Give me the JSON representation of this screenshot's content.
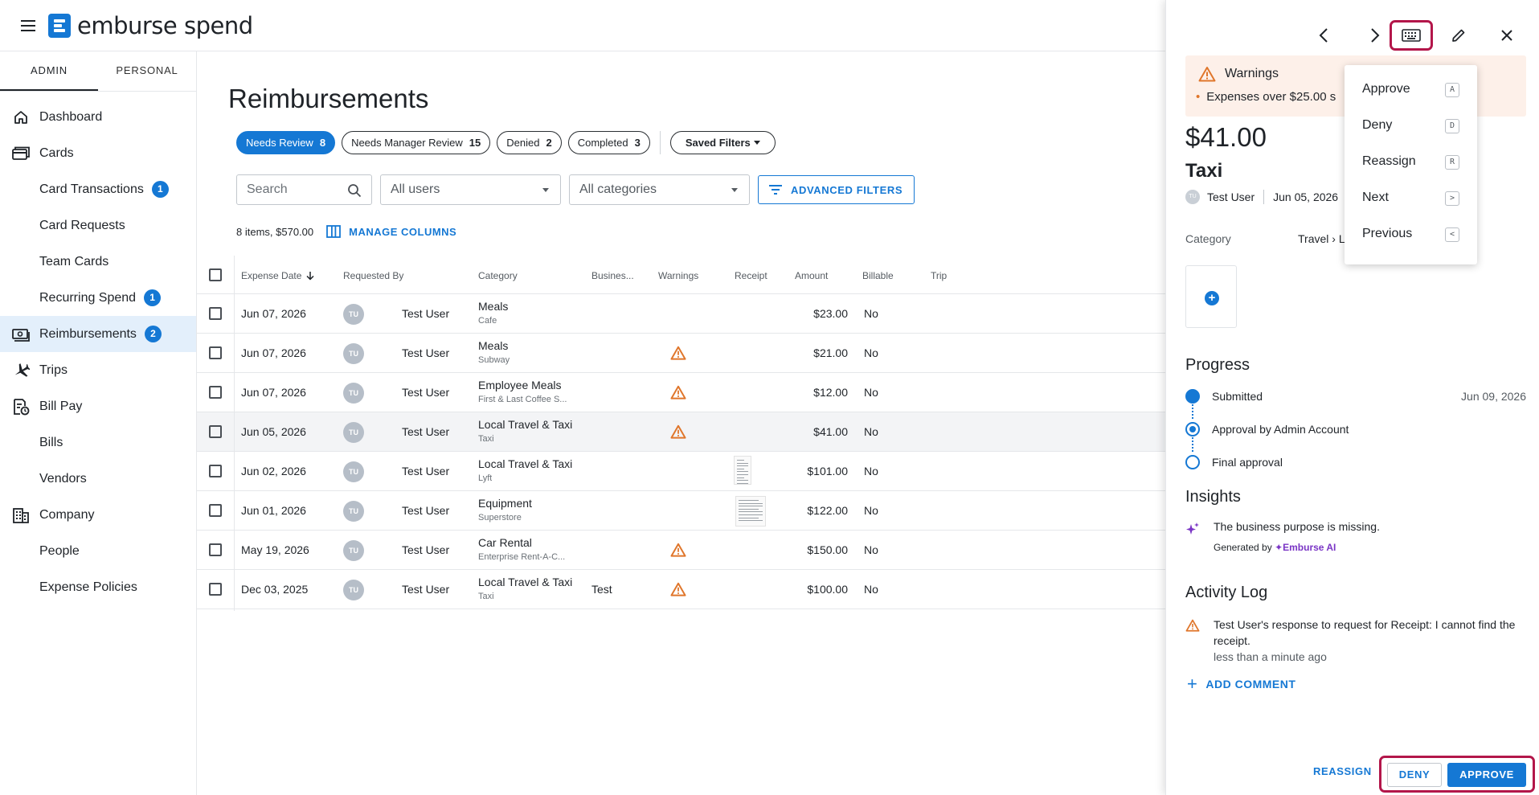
{
  "app": {
    "logo_text": "emburse spend"
  },
  "sidebar": {
    "modes": [
      "ADMIN",
      "PERSONAL"
    ],
    "items": [
      {
        "label": "Dashboard",
        "icon": "home-icon"
      },
      {
        "label": "Cards",
        "icon": "cards-icon"
      },
      {
        "label": "Card Transactions",
        "badge": "1"
      },
      {
        "label": "Card Requests"
      },
      {
        "label": "Team Cards"
      },
      {
        "label": "Recurring Spend",
        "badge": "1"
      },
      {
        "label": "Reimbursements",
        "icon": "reimbursement-icon",
        "badge": "2",
        "active": true
      },
      {
        "label": "Trips",
        "icon": "plane-icon"
      },
      {
        "label": "Bill Pay",
        "icon": "bill-icon"
      },
      {
        "label": "Bills"
      },
      {
        "label": "Vendors"
      },
      {
        "label": "Company",
        "icon": "building-icon"
      },
      {
        "label": "People"
      },
      {
        "label": "Expense Policies"
      }
    ]
  },
  "main": {
    "title": "Reimbursements",
    "chips": [
      {
        "label": "Needs Review",
        "count": "8",
        "active": true
      },
      {
        "label": "Needs Manager Review",
        "count": "15"
      },
      {
        "label": "Denied",
        "count": "2"
      },
      {
        "label": "Completed",
        "count": "3"
      }
    ],
    "saved_filters": "Saved Filters",
    "search_placeholder": "Search",
    "users_select": "All users",
    "categories_select": "All categories",
    "advanced_filters": "ADVANCED FILTERS",
    "summary": "8 items, $570.00",
    "manage_columns": "MANAGE COLUMNS",
    "columns": [
      "Expense Date",
      "Requested By",
      "Category",
      "Busines...",
      "Warnings",
      "Receipt",
      "Amount",
      "Billable",
      "Trip"
    ],
    "rows": [
      {
        "date": "Jun 07, 2026",
        "initials": "TU",
        "user": "Test User",
        "category": "Meals",
        "merchant": "Cafe",
        "business": "",
        "warning": false,
        "receipt": "",
        "amount": "$23.00",
        "billable": "No"
      },
      {
        "date": "Jun 07, 2026",
        "initials": "TU",
        "user": "Test User",
        "category": "Meals",
        "merchant": "Subway",
        "business": "",
        "warning": true,
        "receipt": "",
        "amount": "$21.00",
        "billable": "No"
      },
      {
        "date": "Jun 07, 2026",
        "initials": "TU",
        "user": "Test User",
        "category": "Employee Meals",
        "merchant": "First & Last Coffee S...",
        "business": "",
        "warning": true,
        "receipt": "",
        "amount": "$12.00",
        "billable": "No"
      },
      {
        "date": "Jun 05, 2026",
        "initials": "TU",
        "user": "Test User",
        "category": "Local Travel & Taxi",
        "merchant": "Taxi",
        "business": "",
        "warning": true,
        "receipt": "",
        "amount": "$41.00",
        "billable": "No",
        "highlight": true
      },
      {
        "date": "Jun 02, 2026",
        "initials": "TU",
        "user": "Test User",
        "category": "Local Travel & Taxi",
        "merchant": "Lyft",
        "business": "",
        "warning": false,
        "receipt": "narrow",
        "amount": "$101.00",
        "billable": "No"
      },
      {
        "date": "Jun 01, 2026",
        "initials": "TU",
        "user": "Test User",
        "category": "Equipment",
        "merchant": "Superstore",
        "business": "",
        "warning": false,
        "receipt": "wide",
        "amount": "$122.00",
        "billable": "No"
      },
      {
        "date": "May 19, 2026",
        "initials": "TU",
        "user": "Test User",
        "category": "Car Rental",
        "merchant": "Enterprise Rent-A-C...",
        "business": "",
        "warning": true,
        "receipt": "",
        "amount": "$150.00",
        "billable": "No"
      },
      {
        "date": "Dec 03, 2025",
        "initials": "TU",
        "user": "Test User",
        "category": "Local Travel & Taxi",
        "merchant": "Taxi",
        "business": "Test",
        "warning": true,
        "receipt": "",
        "amount": "$100.00",
        "billable": "No"
      }
    ]
  },
  "panel": {
    "warnings_title": "Warnings",
    "warning_text": "Expenses over $25.00 s",
    "amount": "$41.00",
    "merchant": "Taxi",
    "avatar_initials": "TU",
    "user": "Test User",
    "date": "Jun 05, 2026",
    "category_label": "Category",
    "category_value": "Travel › Lo",
    "progress_title": "Progress",
    "steps": [
      {
        "label": "Submitted",
        "date": "Jun 09, 2026"
      },
      {
        "label": "Approval by Admin Account",
        "date": ""
      },
      {
        "label": "Final approval",
        "date": ""
      }
    ],
    "insights_title": "Insights",
    "insight_text": "The business purpose is missing.",
    "generated_by": "Generated by",
    "ai_name": "Emburse AI",
    "activity_title": "Activity Log",
    "activity_text": "Test User's response to request for Receipt: I cannot find the receipt.",
    "activity_time": "less than a minute ago",
    "add_comment": "ADD COMMENT",
    "reassign": "REASSIGN",
    "deny": "DENY",
    "approve": "APPROVE"
  },
  "shortcut_menu": [
    {
      "label": "Approve",
      "key": "A"
    },
    {
      "label": "Deny",
      "key": "D"
    },
    {
      "label": "Reassign",
      "key": "R"
    },
    {
      "label": "Next",
      "key": ">"
    },
    {
      "label": "Previous",
      "key": "<"
    }
  ],
  "colors": {
    "primary": "#1578d4",
    "warning": "#e0762b",
    "highlight_frame": "#b3164a",
    "ai": "#7a35c5"
  }
}
